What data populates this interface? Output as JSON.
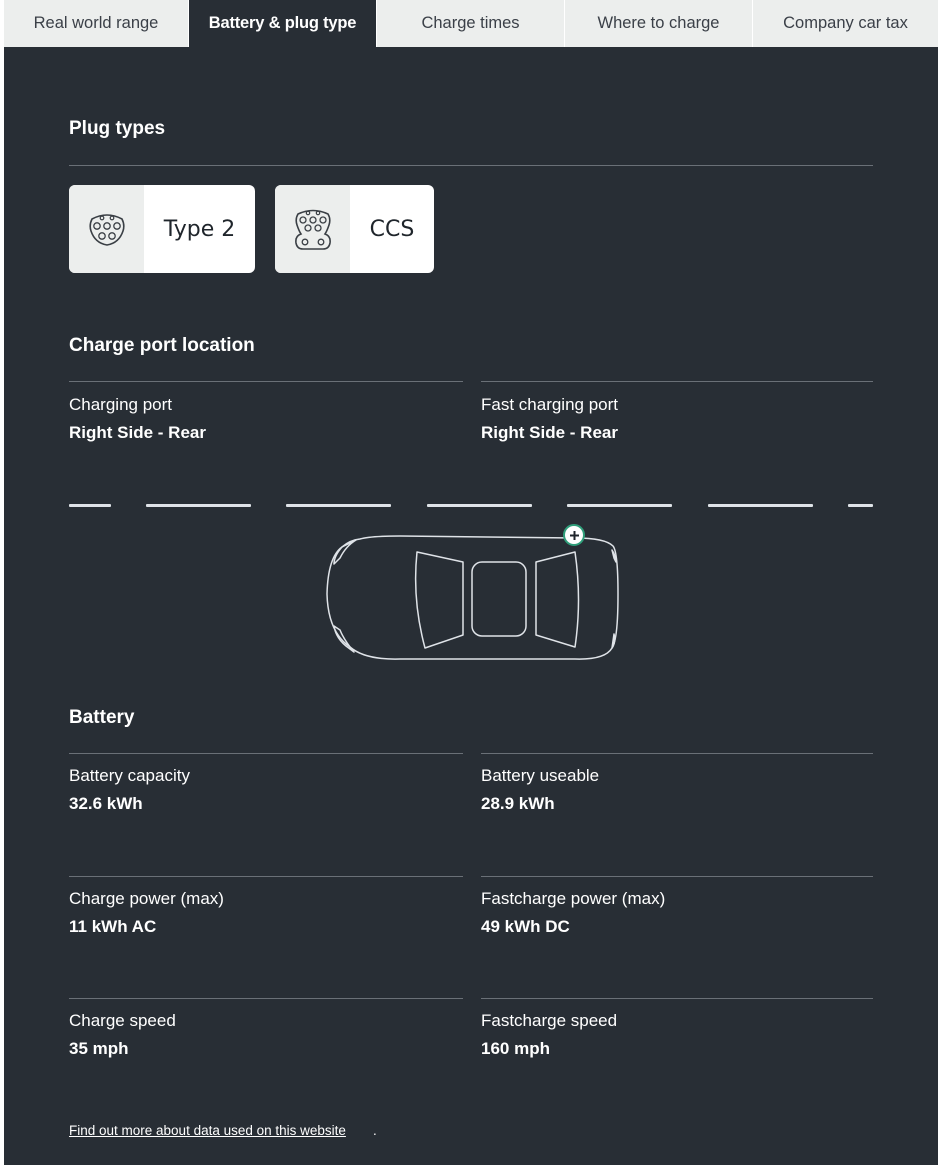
{
  "tabs": [
    {
      "label": "Real world range",
      "active": false
    },
    {
      "label": "Battery & plug type",
      "active": true
    },
    {
      "label": "Charge times",
      "active": false
    },
    {
      "label": "Where to charge",
      "active": false
    },
    {
      "label": "Company car tax",
      "active": false
    }
  ],
  "plug_types": {
    "title": "Plug types",
    "items": [
      {
        "label": "Type 2",
        "icon": "type2-connector-icon"
      },
      {
        "label": "CCS",
        "icon": "ccs-connector-icon"
      }
    ]
  },
  "charge_port": {
    "title": "Charge port location",
    "fields": [
      {
        "label": "Charging port",
        "value": "Right Side - Rear"
      },
      {
        "label": "Fast charging port",
        "value": "Right Side - Rear"
      }
    ],
    "marker_icon": "plus-icon",
    "marker_color": "#2f9e7a"
  },
  "battery": {
    "title": "Battery",
    "fields": [
      {
        "label": "Battery capacity",
        "value": "32.6 kWh"
      },
      {
        "label": "Battery useable",
        "value": "28.9 kWh"
      },
      {
        "label": "Charge power (max)",
        "value": "11 kWh AC"
      },
      {
        "label": "Fastcharge power (max)",
        "value": "49 kWh DC"
      },
      {
        "label": "Charge speed",
        "value": "35 mph"
      },
      {
        "label": "Fastcharge speed",
        "value": "160 mph"
      }
    ]
  },
  "footer": {
    "link_text": "Find out more about data used on this website",
    "trailing": "."
  },
  "colors": {
    "panel_bg": "#282e35",
    "tab_bg": "#eceeed",
    "accent": "#2f9e7a"
  }
}
